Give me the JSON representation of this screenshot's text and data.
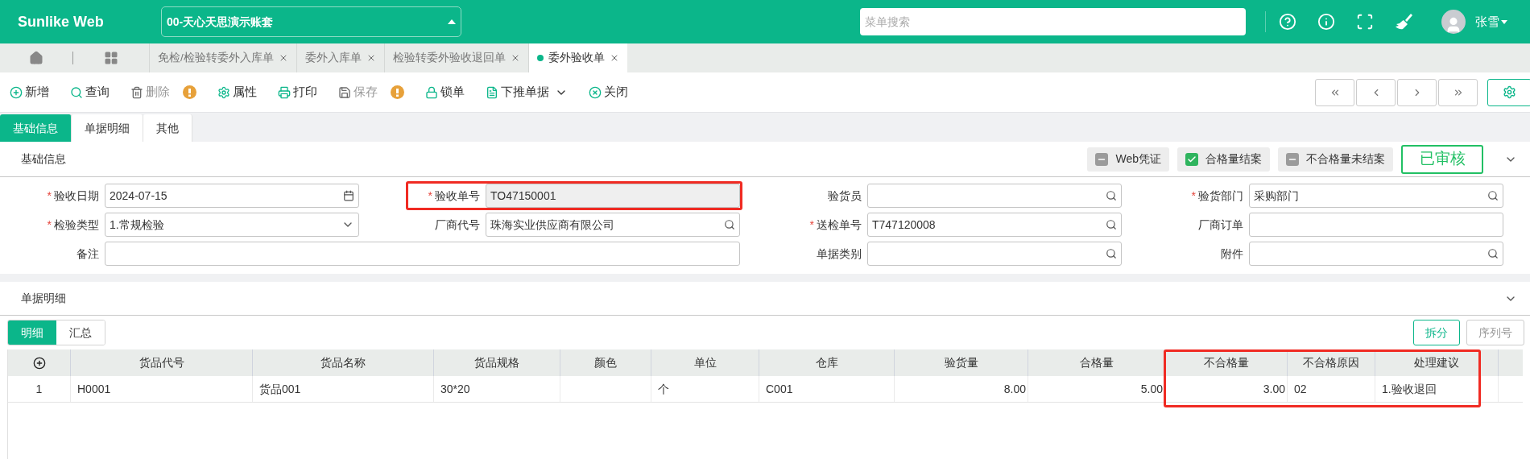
{
  "header": {
    "logo": "Sunlike Web",
    "account": "00-天心天思演示账套",
    "search": {
      "placeholder": "菜单搜索"
    },
    "user": "张雪"
  },
  "tabs": [
    {
      "label": "免检/检验转委外入库单",
      "selected": false
    },
    {
      "label": "委外入库单",
      "selected": false
    },
    {
      "label": "检验转委外验收退回单",
      "selected": false
    },
    {
      "label": "委外验收单",
      "selected": true
    }
  ],
  "toolbar": [
    {
      "label": "新增",
      "disabled": false,
      "warning": false,
      "dropdown": false
    },
    {
      "label": "查询",
      "disabled": false,
      "warning": false,
      "dropdown": false
    },
    {
      "label": "删除",
      "disabled": true,
      "warning": true,
      "dropdown": false
    },
    {
      "label": "属性",
      "disabled": false,
      "warning": false,
      "dropdown": false
    },
    {
      "label": "打印",
      "disabled": false,
      "warning": false,
      "dropdown": false
    },
    {
      "label": "保存",
      "disabled": true,
      "warning": true,
      "dropdown": false
    },
    {
      "label": "锁单",
      "disabled": false,
      "warning": false,
      "dropdown": false
    },
    {
      "label": "下推单据",
      "disabled": false,
      "warning": false,
      "dropdown": true
    },
    {
      "label": "关闭",
      "disabled": false,
      "warning": false,
      "dropdown": false
    }
  ],
  "page_tabs": [
    {
      "label": "基础信息",
      "selected": true
    },
    {
      "label": "单据明细",
      "selected": false
    },
    {
      "label": "其他",
      "selected": false
    }
  ],
  "basic_section": {
    "title": "基础信息",
    "chips": [
      {
        "label": "Web凭证",
        "closed": false
      },
      {
        "label": "合格量结案",
        "closed": true
      },
      {
        "label": "不合格量未结案",
        "closed": false
      }
    ],
    "stamp": "已审核"
  },
  "form_rows": [
    [
      {
        "marker": "*",
        "label": "验收日期",
        "value": "2024-07-15",
        "kind": "date"
      },
      {
        "marker": "*",
        "label": "验收单号",
        "value": "TO47150001",
        "kind": "readonly",
        "annotated": true
      },
      {
        "label": "验货员",
        "kind": "lookup"
      },
      {
        "marker": "*",
        "label": "验货部门",
        "value": "采购部门",
        "kind": "lookup"
      }
    ],
    [
      {
        "marker": "*",
        "label": "检验类型",
        "value": "1.常规检验",
        "kind": "select"
      },
      {
        "label": "厂商代号",
        "value": "珠海实业供应商有限公司",
        "kind": "lookup"
      },
      {
        "marker": "*",
        "label": "送检单号",
        "value": "T747120008",
        "kind": "lookup"
      },
      {
        "label": "厂商订单",
        "kind": "text"
      }
    ],
    [
      {
        "label": "备注",
        "kind": "text",
        "wide": true
      },
      {
        "label": "单据类别",
        "kind": "lookup"
      },
      {
        "label": "附件",
        "kind": "lookup"
      }
    ]
  ],
  "detail_section": {
    "title": "单据明细",
    "tabs": [
      {
        "label": "明细",
        "selected": true
      },
      {
        "label": "汇总",
        "selected": false
      }
    ],
    "buttons": [
      {
        "label": "拆分",
        "disabled": false
      },
      {
        "label": "序列号",
        "disabled": true
      }
    ]
  },
  "table": {
    "columns": [
      {
        "kind": "add"
      },
      {
        "label": "货品代号",
        "numeric": false
      },
      {
        "label": "货品名称",
        "numeric": false
      },
      {
        "label": "货品规格",
        "numeric": false
      },
      {
        "label": "颜色"
      },
      {
        "label": "单位",
        "numeric": false
      },
      {
        "label": "仓库",
        "numeric": false
      },
      {
        "label": "验货量",
        "numeric": true
      },
      {
        "label": "合格量",
        "numeric": true
      },
      {
        "label": "不合格量",
        "numeric": true,
        "annotated": true
      },
      {
        "label": "不合格原因",
        "numeric": false,
        "annotated": true
      },
      {
        "label": "处理建议",
        "numeric": false,
        "annotated": true
      }
    ],
    "rows": [
      [
        "1",
        "H0001",
        "货品001",
        "30*20",
        null,
        "个",
        "C001",
        "8.00",
        "5.00",
        "3.00",
        "02",
        "1.验收退回"
      ]
    ]
  }
}
